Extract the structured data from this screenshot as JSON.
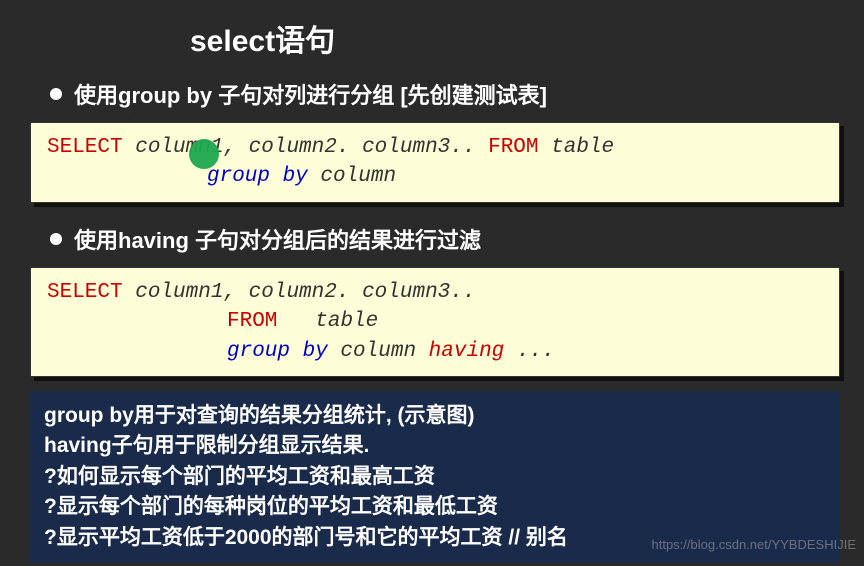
{
  "title": "select语句",
  "section1": {
    "heading": "使用group by 子句对列进行分组 [先创建测试表]",
    "code": {
      "line1": {
        "select": "SELECT",
        "cols": " column1, column2. column3.. ",
        "from": "FROM",
        "table": " table"
      },
      "line2": {
        "groupby": "group by",
        "col": " column"
      }
    }
  },
  "section2": {
    "heading": "使用having 子句对分组后的结果进行过滤",
    "code": {
      "line1": {
        "select": "SELECT",
        "cols": " column1, column2. column3.."
      },
      "line2": {
        "from": "FROM",
        "gap": "   ",
        "table": "table"
      },
      "line3": {
        "groupby": "group by",
        "col": " column ",
        "having": "having",
        "dots": " ..."
      }
    }
  },
  "summary": {
    "l1": "group by用于对查询的结果分组统计, (示意图)",
    "l2": "having子句用于限制分组显示结果.",
    "l3": "?如何显示每个部门的平均工资和最高工资",
    "l4": "?显示每个部门的每种岗位的平均工资和最低工资",
    "l5": "?显示平均工资低于2000的部门号和它的平均工资 // 别名"
  },
  "watermark": "https://blog.csdn.net/YYBDESHIJIE"
}
